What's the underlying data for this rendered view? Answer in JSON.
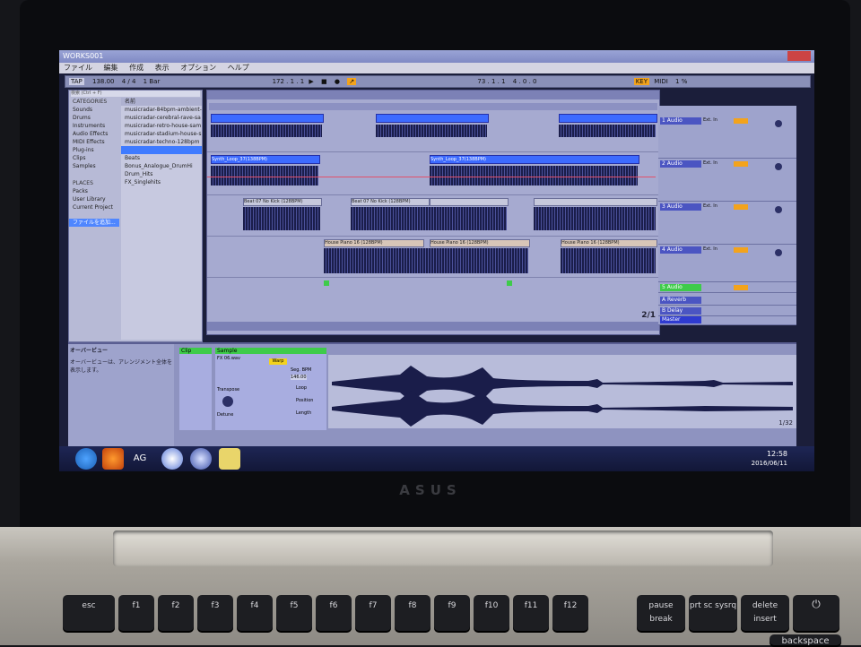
{
  "app": {
    "title": "WORKS001",
    "menus": [
      "ファイル",
      "編集",
      "作成",
      "表示",
      "オプション",
      "ヘルプ"
    ],
    "transport": {
      "tap": "TAP",
      "tempo": "138.00",
      "signature": "4 / 4",
      "quantize": "1 Bar",
      "position": "172 . 1 . 1",
      "loop_start": "73 . 1 . 1",
      "loop_length": "4 . 0 . 0",
      "key": "KEY",
      "midi": "MIDI",
      "cpu": "1 %"
    }
  },
  "browser": {
    "search_placeholder": "検索 (Ctrl + F)",
    "categories_header": "CATEGORIES",
    "categories": [
      "Sounds",
      "Drums",
      "Instruments",
      "Audio Effects",
      "MIDI Effects",
      "Plug-ins",
      "Clips",
      "Samples"
    ],
    "places_header": "PLACES",
    "places": [
      "Packs",
      "User Library",
      "Current Project",
      "ファイルを追加..."
    ],
    "name_header": "名前",
    "files": [
      "musicradar-84bpm-ambient-sam",
      "musicradar-cerebral-rave-sa",
      "musicradar-retro-house-sam",
      "musicradar-stadium-house-s",
      "musicradar-techno-128bpm",
      "Beats",
      "Bonus_Analogue_DrumHi",
      "Drum_Hits",
      "FX_Singlehits"
    ]
  },
  "arrangement": {
    "clips": [
      {
        "track": 1,
        "label": ""
      },
      {
        "track": 2,
        "label": "Synth_Loop_37(138BPM)"
      },
      {
        "track": 2,
        "label": "Synth_Loop_37(138BPM)"
      },
      {
        "track": 3,
        "label": "Beat 07 No Kick (128BPM)"
      },
      {
        "track": 3,
        "label": "Beat 07 No Kick (128BPM)"
      },
      {
        "track": 4,
        "label": "House Piano 16 (128BPM)"
      },
      {
        "track": 4,
        "label": "House Piano 16 (128BPM)"
      },
      {
        "track": 4,
        "label": "House Piano 16 (128BPM)"
      }
    ],
    "page_indicator": "2/1"
  },
  "mixer": {
    "tracks": [
      {
        "name": "1 Audio",
        "input": "Ext. In",
        "monitor": "Auto"
      },
      {
        "name": "2 Audio",
        "input": "Ext. In",
        "monitor": "Auto"
      },
      {
        "name": "3 Audio",
        "input": "Ext. In",
        "monitor": "Auto"
      },
      {
        "name": "4 Audio",
        "input": "Ext. In",
        "monitor": "Auto"
      },
      {
        "name": "5 Audio",
        "input": "Ext. In",
        "monitor": "Auto"
      }
    ],
    "returns": [
      "A Reverb",
      "B Delay",
      "Master"
    ]
  },
  "detail": {
    "help_title": "オーバービュー",
    "help_text": "オーバービューは、アレンジメント全体を表示します。",
    "clip_header": "Clip",
    "sample_header": "Sample",
    "sample_name": "FX 06.wav",
    "warp": "Warp",
    "seg_bpm": "Seg. BPM",
    "bpm_value": "146.00",
    "transpose": "Transpose",
    "detune": "Detune",
    "loop": "Loop",
    "position": "Position",
    "length": "Length",
    "zoom": "1/32"
  },
  "taskbar": {
    "start_label": "AG",
    "time": "12:58",
    "date": "2016/06/11"
  },
  "laptop": {
    "brand": "ASUS",
    "keys": [
      "esc",
      "f1",
      "f2",
      "f3",
      "f4",
      "f5",
      "f6",
      "f7",
      "f8",
      "f9",
      "f10",
      "f11",
      "f12",
      "pause break",
      "prt sc sysrq",
      "delete insert",
      ""
    ],
    "bottom_key": "backspace"
  }
}
